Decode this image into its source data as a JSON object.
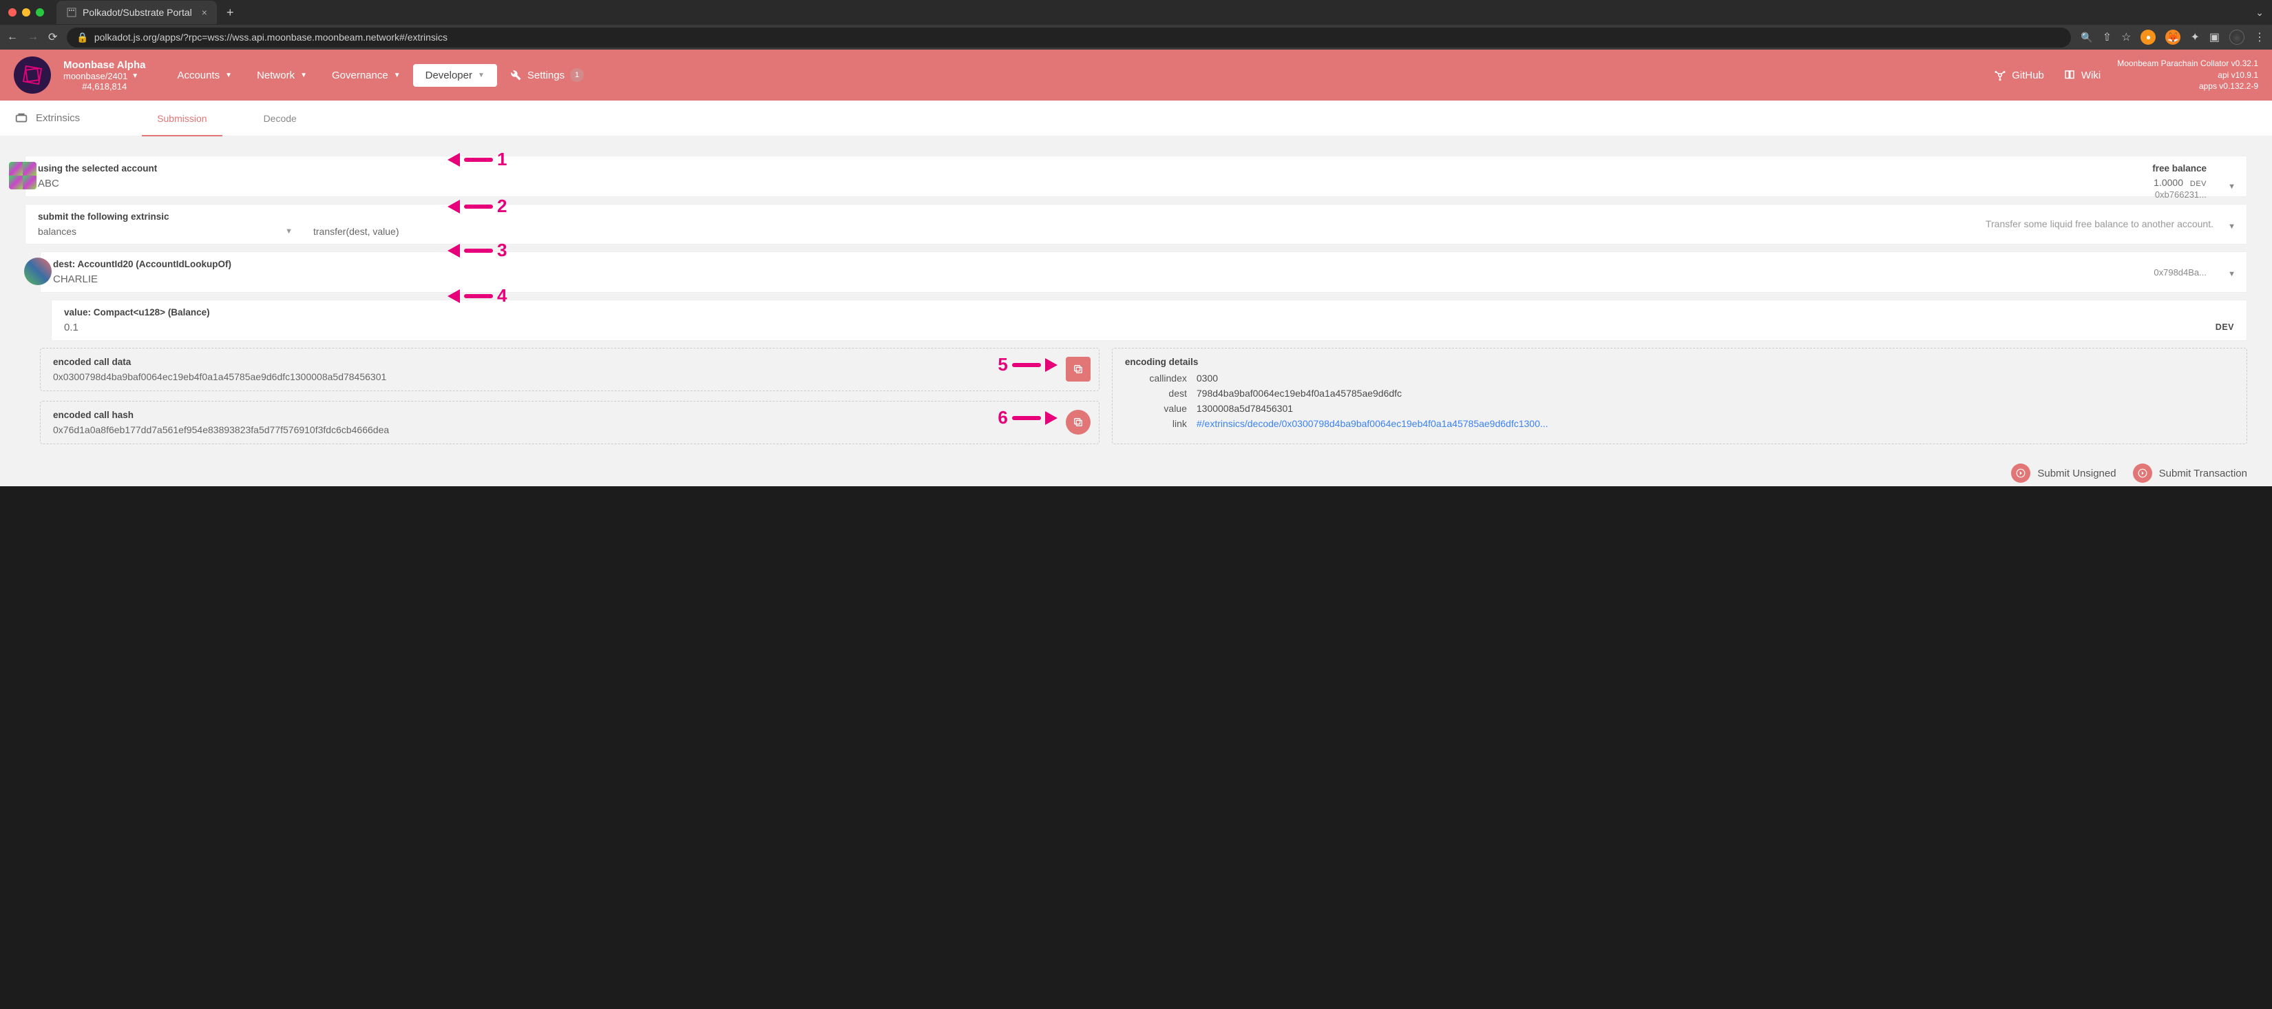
{
  "browser": {
    "tab_title": "Polkadot/Substrate Portal",
    "url": "polkadot.js.org/apps/?rpc=wss://wss.api.moonbase.moonbeam.network#/extrinsics"
  },
  "header": {
    "chain_name": "Moonbase Alpha",
    "chain_spec": "moonbase/2401",
    "block_number": "#4,618,814",
    "nav": {
      "accounts": "Accounts",
      "network": "Network",
      "governance": "Governance",
      "developer": "Developer",
      "settings": "Settings",
      "settings_badge": "1",
      "github": "GitHub",
      "wiki": "Wiki"
    },
    "versions": {
      "collator": "Moonbeam Parachain Collator v0.32.1",
      "api": "api v10.9.1",
      "apps": "apps v0.132.2-9"
    }
  },
  "subtabs": {
    "title": "Extrinsics",
    "submission": "Submission",
    "decode": "Decode"
  },
  "form": {
    "account": {
      "label": "using the selected account",
      "name": "ABC",
      "balance_label": "free balance",
      "balance_value": "1.0000",
      "balance_currency": "DEV",
      "address": "0xb766231..."
    },
    "extrinsic": {
      "label": "submit the following extrinsic",
      "pallet": "balances",
      "method": "transfer(dest, value)",
      "method_desc": "Transfer some liquid free balance to another account."
    },
    "dest": {
      "label": "dest: AccountId20 (AccountIdLookupOf)",
      "name": "CHARLIE",
      "address": "0x798d4Ba..."
    },
    "value": {
      "label": "value: Compact<u128> (Balance)",
      "amount": "0.1",
      "token": "DEV"
    }
  },
  "encoded": {
    "calldata_label": "encoded call data",
    "calldata": "0x0300798d4ba9baf0064ec19eb4f0a1a45785ae9d6dfc1300008a5d78456301",
    "callhash_label": "encoded call hash",
    "callhash": "0x76d1a0a8f6eb177dd7a561ef954e83893823fa5d77f576910f3fdc6cb4666dea"
  },
  "details": {
    "title": "encoding details",
    "callindex_k": "callindex",
    "callindex_v": "0300",
    "dest_k": "dest",
    "dest_v": "798d4ba9baf0064ec19eb4f0a1a45785ae9d6dfc",
    "value_k": "value",
    "value_v": "1300008a5d78456301",
    "link_k": "link",
    "link_v": "#/extrinsics/decode/0x0300798d4ba9baf0064ec19eb4f0a1a45785ae9d6dfc1300..."
  },
  "buttons": {
    "unsigned": "Submit Unsigned",
    "submit": "Submit Transaction"
  },
  "arrows": {
    "a1": "1",
    "a2": "2",
    "a3": "3",
    "a4": "4",
    "a5": "5",
    "a6": "6"
  }
}
